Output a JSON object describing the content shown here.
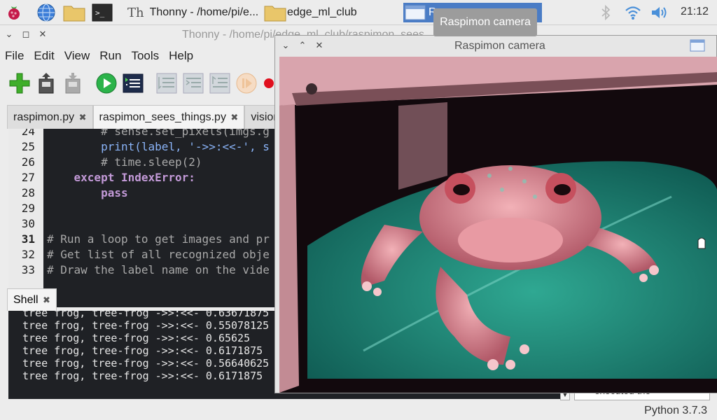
{
  "taskbar": {
    "tasks": [
      {
        "label": "Thonny  -  /home/pi/e..."
      },
      {
        "label": "edge_ml_club"
      },
      {
        "label": "Ras..."
      }
    ],
    "clock": "21:12"
  },
  "tooltip": "Raspimon camera",
  "thonny": {
    "title": "Thonny  -  /home/pi/edge_ml_club/raspimon_sees_",
    "menu": [
      "File",
      "Edit",
      "View",
      "Run",
      "Tools",
      "Help"
    ],
    "tabs": [
      {
        "label": "raspimon.py"
      },
      {
        "label": "raspimon_sees_things.py"
      },
      {
        "label": "vision."
      }
    ],
    "editor": {
      "lines": [
        {
          "num": "24",
          "code": "        # sense.set_pixels(imgs.g"
        },
        {
          "num": "25",
          "code": "        print(label, '->>:<<-', s"
        },
        {
          "num": "26",
          "code": "        # time.sleep(2)"
        },
        {
          "num": "27",
          "code": "    except IndexError:"
        },
        {
          "num": "28",
          "code": "        pass"
        },
        {
          "num": "29",
          "code": ""
        },
        {
          "num": "30",
          "code": ""
        },
        {
          "num": "31",
          "code": "# Run a loop to get images and pr"
        },
        {
          "num": "32",
          "code": "# Get list of all recognized obje"
        },
        {
          "num": "33",
          "code": "# Draw the label name on the vide"
        }
      ]
    },
    "shell": {
      "tab_label": "Shell",
      "lines": [
        "tree frog, tree-frog ->>:<<- 0.63671875",
        "tree frog, tree-frog ->>:<<- 0.55078125",
        "tree frog, tree-frog ->>:<<- 0.65625",
        "tree frog, tree-frog ->>:<<- 0.6171875",
        "tree frog, tree-frog ->>:<<- 0.56640625",
        "tree frog, tree-frog ->>:<<- 0.6171875"
      ]
    },
    "assistant_text": "executed the",
    "status": "Python 3.7.3"
  },
  "camera": {
    "title": "Raspimon camera"
  }
}
